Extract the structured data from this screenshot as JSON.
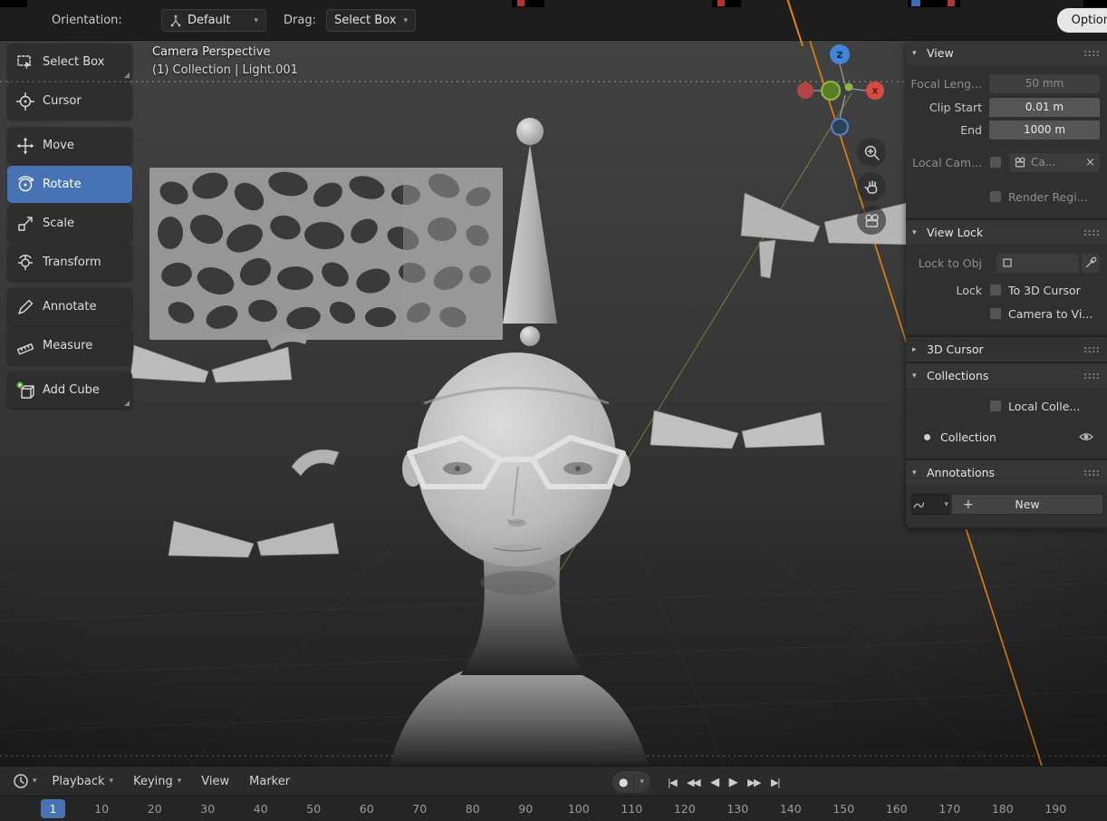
{
  "topbar": {
    "orientation_label": "Orientation:",
    "orientation_value": "Default",
    "drag_label": "Drag:",
    "drag_value": "Select Box",
    "options_button": "Option"
  },
  "toolbar": {
    "active_item": "Rotate",
    "items": [
      {
        "label": "Select Box"
      },
      {
        "label": "Cursor"
      },
      {
        "label": "Move"
      },
      {
        "label": "Rotate"
      },
      {
        "label": "Scale"
      },
      {
        "label": "Transform"
      },
      {
        "label": "Annotate"
      },
      {
        "label": "Measure"
      },
      {
        "label": "Add Cube"
      }
    ]
  },
  "viewport": {
    "overlay": {
      "line1": "Camera Perspective",
      "line2": "(1) Collection | Light.001"
    },
    "gizmo": {
      "z_label": "Z",
      "x_label": "X"
    }
  },
  "sidebar": {
    "view": {
      "title": "View",
      "focal_label": "Focal Leng...",
      "focal_value": "50 mm",
      "clip_start_label": "Clip Start",
      "clip_start_value": "0.01 m",
      "clip_end_label": "End",
      "clip_end_value": "1000 m",
      "local_camera_label": "Local Cam...",
      "local_camera_value": "Ca...",
      "render_region_label": "Render Regi..."
    },
    "view_lock": {
      "title": "View Lock",
      "lock_to_object_label": "Lock to Obj",
      "lock_label": "Lock",
      "to_3d_cursor_label": "To 3D Cursor",
      "camera_to_view_label": "Camera to Vi..."
    },
    "cursor_3d": {
      "title": "3D Cursor"
    },
    "collections": {
      "title": "Collections",
      "local_collections_label": "Local Colle...",
      "items": [
        {
          "name": "Collection"
        }
      ]
    },
    "annotations": {
      "title": "Annotations",
      "new_button": "New"
    }
  },
  "timeline": {
    "menus": {
      "playback": "Playback",
      "keying": "Keying",
      "view": "View",
      "marker": "Marker"
    },
    "transport": {
      "record_glyph": "●",
      "buttons": [
        {
          "name": "jump-to-start",
          "glyph": "|◀"
        },
        {
          "name": "prev-keyframe",
          "glyph": "◀◀"
        },
        {
          "name": "play-reverse",
          "glyph": "◀"
        },
        {
          "name": "play",
          "glyph": "▶"
        },
        {
          "name": "next-keyframe",
          "glyph": "▶▶"
        },
        {
          "name": "jump-to-end",
          "glyph": "▶|"
        }
      ]
    },
    "current_frame": "1",
    "ruler_ticks": [
      "10",
      "20",
      "30",
      "40",
      "50",
      "60",
      "70",
      "80",
      "90",
      "100",
      "110",
      "120",
      "130",
      "140",
      "150",
      "160",
      "170",
      "180",
      "190"
    ]
  },
  "colors": {
    "accent_blue": "#4772b3",
    "axis_x_red": "#d84a45",
    "axis_y_green": "#8db543",
    "axis_z_blue": "#4284d7",
    "light_path_orange": "#e8830c"
  }
}
